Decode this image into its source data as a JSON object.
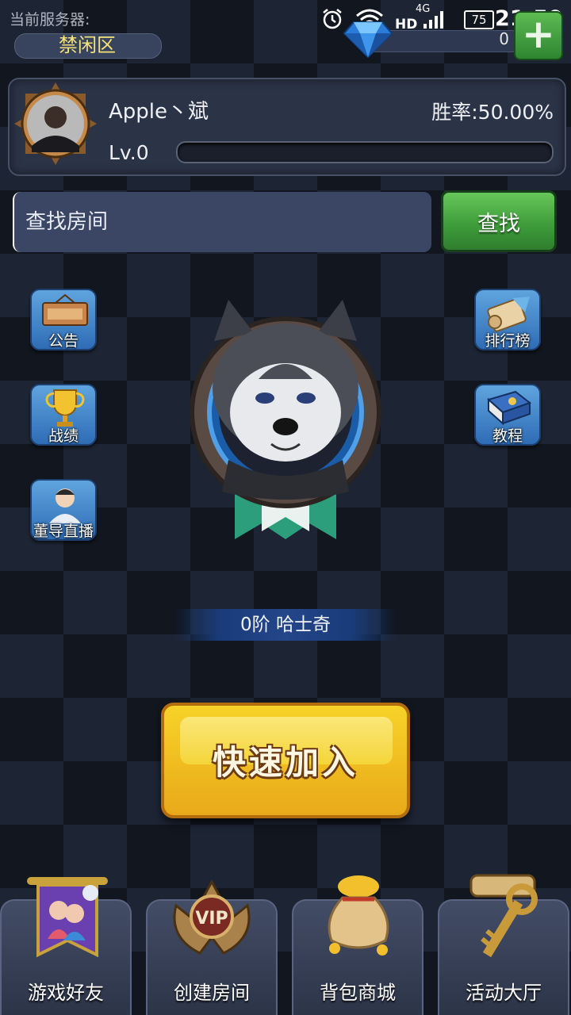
{
  "status_bar": {
    "time": "21:59",
    "battery": "75",
    "network": "4G",
    "hd": "HD",
    "icons": [
      "alarm-icon",
      "wifi-icon",
      "signal-icon"
    ]
  },
  "server": {
    "label": "当前服务器:",
    "name": "禁闲区"
  },
  "currency": {
    "diamonds": "0",
    "add_label": "+"
  },
  "profile": {
    "name": "Apple丶斌",
    "win_rate": "胜率:50.00%",
    "level": "Lv.0",
    "xp_progress": 0
  },
  "search": {
    "placeholder": "查找房间",
    "button_label": "查找"
  },
  "side_buttons": {
    "left": [
      {
        "label": "公告",
        "icon": "notice-board-icon"
      },
      {
        "label": "战绩",
        "icon": "trophy-icon"
      },
      {
        "label": "董导直播",
        "icon": "streamer-avatar-icon"
      }
    ],
    "right": [
      {
        "label": "排行榜",
        "icon": "scroll-icon"
      },
      {
        "label": "教程",
        "icon": "book-icon"
      }
    ]
  },
  "mascot": {
    "rank_text": "0阶  哈士奇"
  },
  "quick_join": {
    "label": "快速加入"
  },
  "bottom_nav": [
    {
      "label": "游戏好友",
      "icon": "friends-banner-icon"
    },
    {
      "label": "创建房间",
      "icon": "vip-badge-icon"
    },
    {
      "label": "背包商城",
      "icon": "gold-bag-icon"
    },
    {
      "label": "活动大厅",
      "icon": "key-scroll-icon"
    }
  ],
  "colors": {
    "accent_green": "#3f9e3b",
    "accent_yellow": "#f4c523",
    "side_button_blue": "#3b7fc6",
    "server_name_yellow": "#f6e37a"
  }
}
